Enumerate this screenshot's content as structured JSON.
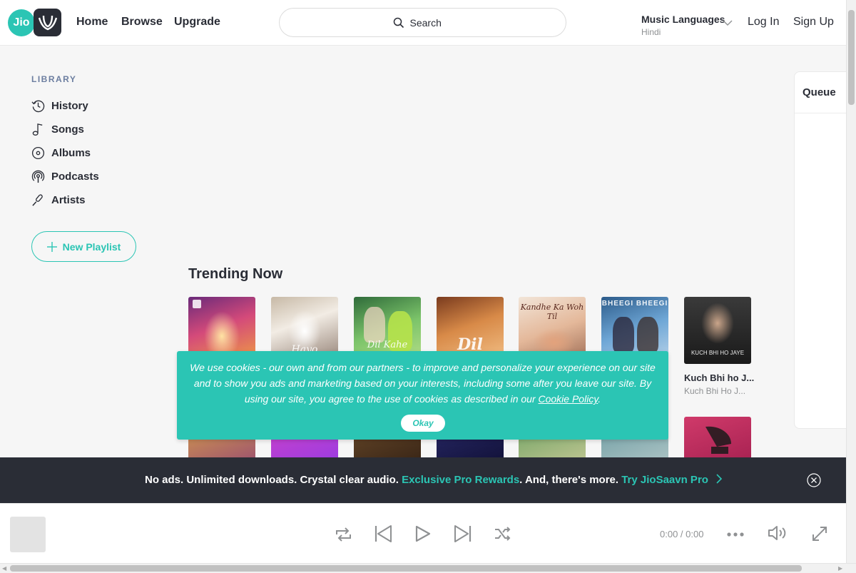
{
  "header": {
    "logo_text": "Jio",
    "nav": [
      "Home",
      "Browse",
      "Upgrade"
    ],
    "search_placeholder": "Search",
    "music_languages_label": "Music Languages",
    "music_languages_value": "Hindi",
    "login_label": "Log In",
    "signup_label": "Sign Up"
  },
  "sidebar": {
    "section_label": "LIBRARY",
    "items": [
      {
        "label": "History",
        "icon": "history-icon"
      },
      {
        "label": "Songs",
        "icon": "music-note-icon"
      },
      {
        "label": "Albums",
        "icon": "album-icon"
      },
      {
        "label": "Podcasts",
        "icon": "podcast-icon"
      },
      {
        "label": "Artists",
        "icon": "microphone-icon"
      }
    ],
    "new_playlist_label": "New Playlist"
  },
  "queue": {
    "title": "Queue"
  },
  "trending": {
    "title": "Trending Now",
    "row1": [
      {
        "cover_text": ""
      },
      {
        "cover_text": "Hayo"
      },
      {
        "cover_text": "Dil Kahe"
      },
      {
        "cover_text": "Dil"
      },
      {
        "cover_text": "Kandhe Ka Woh Til"
      },
      {
        "cover_text": "BHEEGI BHEEGI"
      },
      {
        "cover_text": "KUCH BHI HO JAYE",
        "title": "Kuch Bhi ho J...",
        "subtitle": "Kuch Bhi Ho J..."
      }
    ]
  },
  "cookie": {
    "text": "We use cookies - our own and from our partners - to improve and personalize your experience on our site and to show you ads and marketing based on your interests, including some after you leave our site. By using our site, you agree to the use of cookies as described in our ",
    "link_label": "Cookie Policy",
    "end_punct": ".",
    "button_label": "Okay"
  },
  "promo": {
    "text_1": "No ads. Unlimited downloads. Crystal clear audio. ",
    "link_1": "Exclusive Pro Rewards",
    "text_2": ". And, there's more. ",
    "link_2": "Try JioSaavn Pro"
  },
  "player": {
    "time": "0:00 / 0:00"
  },
  "colors": {
    "accent": "#2bc5b4",
    "dark": "#2a2d36",
    "muted": "#8f9193"
  }
}
